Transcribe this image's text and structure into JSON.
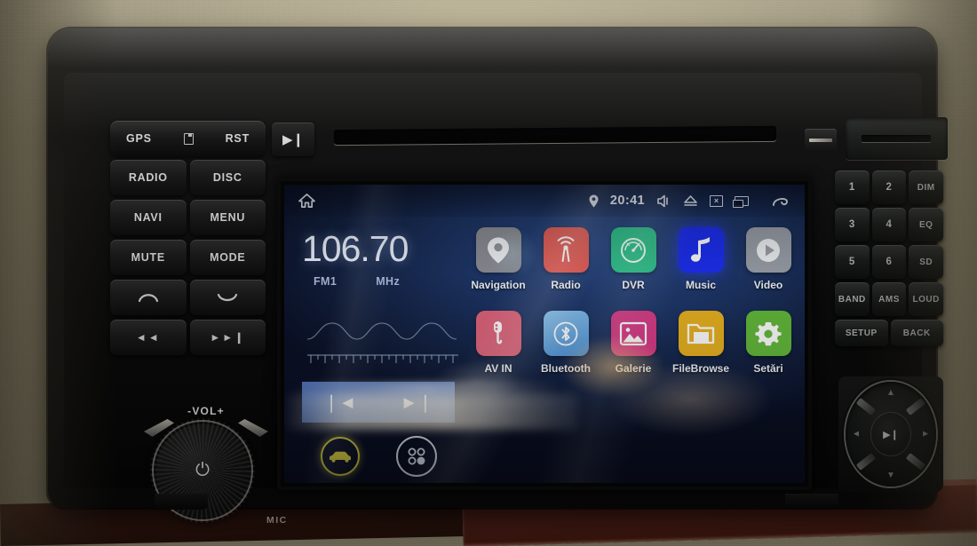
{
  "device": {
    "name": "android-car-head-unit",
    "brand_colors": {
      "accent_blue": "#3e60a6",
      "screen_bg": "#1d3566",
      "yellow": "#d7d042"
    }
  },
  "hardware": {
    "left_panel": {
      "top_row": {
        "gps_label": "GPS",
        "sd_icon": "sd-card-icon",
        "rst_label": "RST"
      },
      "play_button": "▶❙",
      "rows": [
        {
          "left": "RADIO",
          "right": "DISC"
        },
        {
          "left": "NAVI",
          "right": "MENU"
        },
        {
          "left": "MUTE",
          "right": "MODE"
        },
        {
          "left": "call-answer-icon",
          "right": "call-end-icon"
        },
        {
          "left": "◄◄",
          "right": "►►❙"
        }
      ],
      "volume_label": "-VOL+",
      "power_icon": "⏻",
      "mic_label": "MIC"
    },
    "right_panel": {
      "rows": [
        [
          "1",
          "2",
          "DIM"
        ],
        [
          "3",
          "4",
          "EQ"
        ],
        [
          "5",
          "6",
          "SD"
        ],
        [
          "BAND",
          "AMS",
          "LOUD"
        ],
        [
          "SETUP",
          "BACK"
        ]
      ],
      "dpad": {
        "center": "▶❙",
        "up": "▲",
        "down": "▼",
        "left": "◄",
        "right": "►"
      }
    },
    "cd_slot": "cd-slot",
    "eject_button": "eject-button",
    "card_slot": "sd-card-slot"
  },
  "screen": {
    "statusbar": {
      "home_icon": "home-icon",
      "location_icon": "location-pin-icon",
      "clock": "20:41",
      "volume_icon": "volume-mute-icon",
      "eject_icon": "eject-icon",
      "close_icon": "close-box-icon",
      "recents_icon": "recent-apps-icon",
      "back_icon": "back-arrow-icon"
    },
    "radio_widget": {
      "frequency": "106.70",
      "band": "FM1",
      "unit": "MHz",
      "prev_label": "❘◄",
      "next_label": "►❘",
      "car_icon": "car-icon",
      "apps_icon": "all-apps-icon"
    },
    "apps": [
      {
        "label": "Navigation",
        "icon": "map-pin-icon",
        "bg": "#8c8f96",
        "fg": "#ffffff"
      },
      {
        "label": "Radio",
        "icon": "radio-waves-icon",
        "bg": "#e35b55",
        "fg": "#ffffff"
      },
      {
        "label": "DVR",
        "icon": "dashcam-icon",
        "bg": "#2ec08a",
        "fg": "#ffffff"
      },
      {
        "label": "Music",
        "icon": "music-note-icon",
        "bg": "#1d2ff0",
        "fg": "#ffffff"
      },
      {
        "label": "Video",
        "icon": "play-circle-icon",
        "bg": "#9aa0a9",
        "fg": "#ffffff"
      },
      {
        "label": "AV IN",
        "icon": "av-in-icon",
        "bg": "#e0647c",
        "fg": "#ffffff"
      },
      {
        "label": "Bluetooth",
        "icon": "bluetooth-icon",
        "bg": "#5fa3e0",
        "fg": "#ffffff"
      },
      {
        "label": "Galerie",
        "icon": "photo-icon",
        "bg": "#d63a86",
        "fg": "#ffffff"
      },
      {
        "label": "FileBrowse",
        "icon": "folder-icon",
        "bg": "#e8b220",
        "fg": "#ffffff"
      },
      {
        "label": "Setări",
        "icon": "gear-icon",
        "bg": "#63ba3c",
        "fg": "#ffffff"
      }
    ]
  }
}
